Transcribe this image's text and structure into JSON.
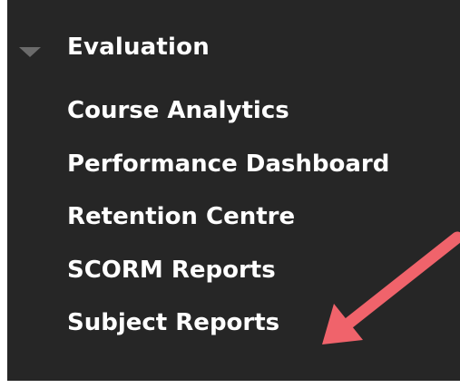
{
  "section": {
    "title": "Evaluation",
    "caret_icon": "triangle-down-icon"
  },
  "menu": {
    "items": [
      {
        "label": "Course Analytics"
      },
      {
        "label": "Performance Dashboard"
      },
      {
        "label": "Retention Centre"
      },
      {
        "label": "SCORM Reports"
      },
      {
        "label": "Subject Reports"
      }
    ]
  },
  "annotation": {
    "arrow_icon": "annotation-arrow-icon",
    "color": "#f0636b"
  },
  "colors": {
    "panel_bg": "#262626",
    "text": "#ffffff",
    "caret": "#6b6b6b"
  }
}
